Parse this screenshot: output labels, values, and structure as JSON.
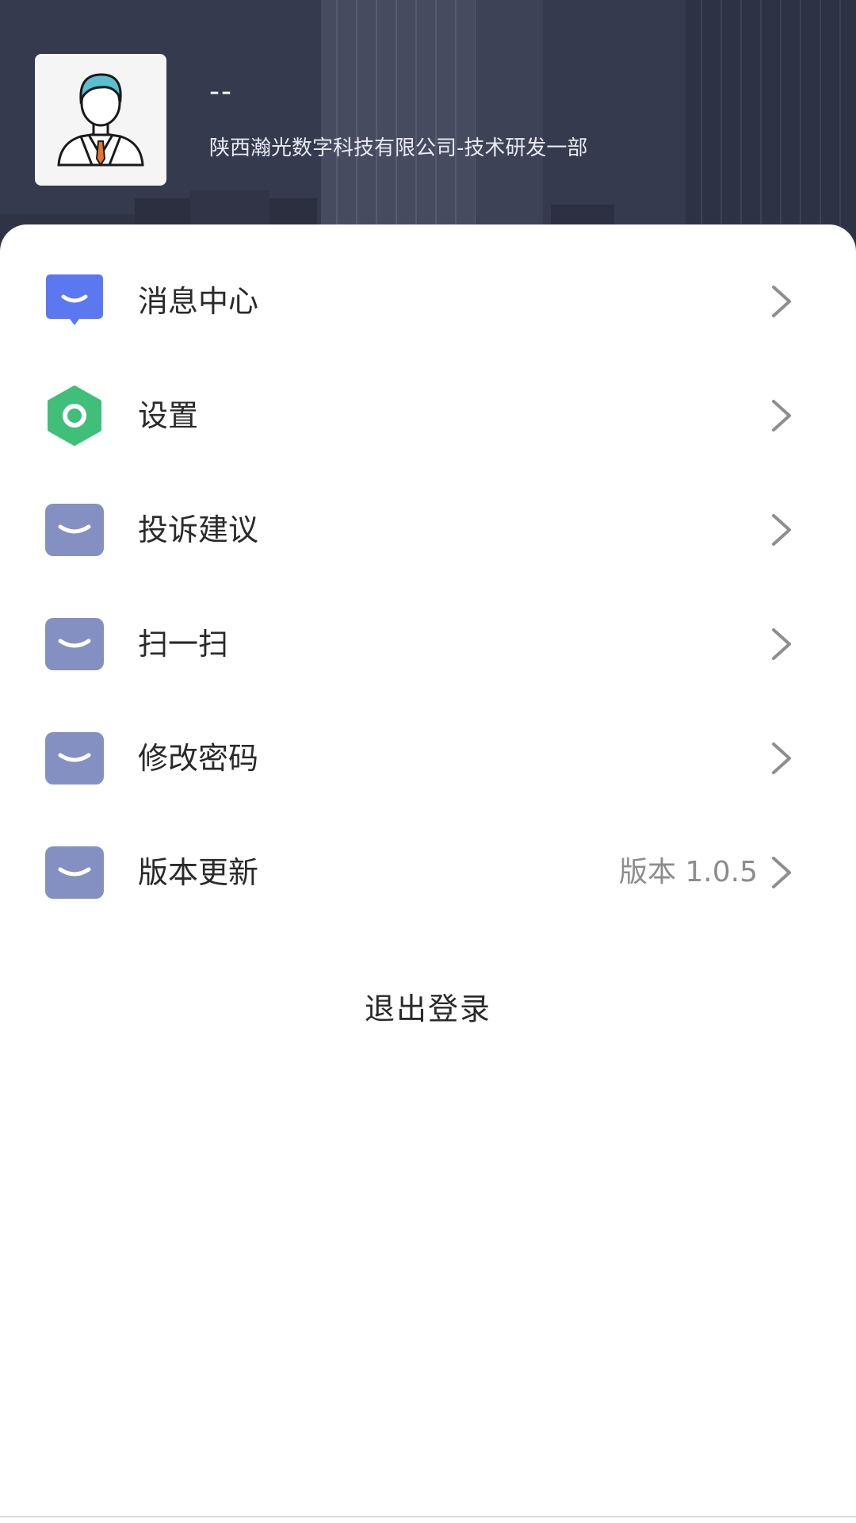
{
  "user": {
    "name": "--",
    "org": "陕西瀚光数字科技有限公司-技术研发一部"
  },
  "menu": [
    {
      "label": "消息中心",
      "icon": "message-center-icon",
      "value": ""
    },
    {
      "label": "设置",
      "icon": "settings-icon",
      "value": ""
    },
    {
      "label": "投诉建议",
      "icon": "complaint-icon",
      "value": ""
    },
    {
      "label": "扫一扫",
      "icon": "scan-icon",
      "value": ""
    },
    {
      "label": "修改密码",
      "icon": "change-password-icon",
      "value": ""
    },
    {
      "label": "版本更新",
      "icon": "version-update-icon",
      "value": "版本 1.0.5"
    }
  ],
  "logout_label": "退出登录",
  "colors": {
    "message_icon": "#5b78f0",
    "settings_icon": "#3fbf78",
    "default_icon": "#8590c2"
  }
}
